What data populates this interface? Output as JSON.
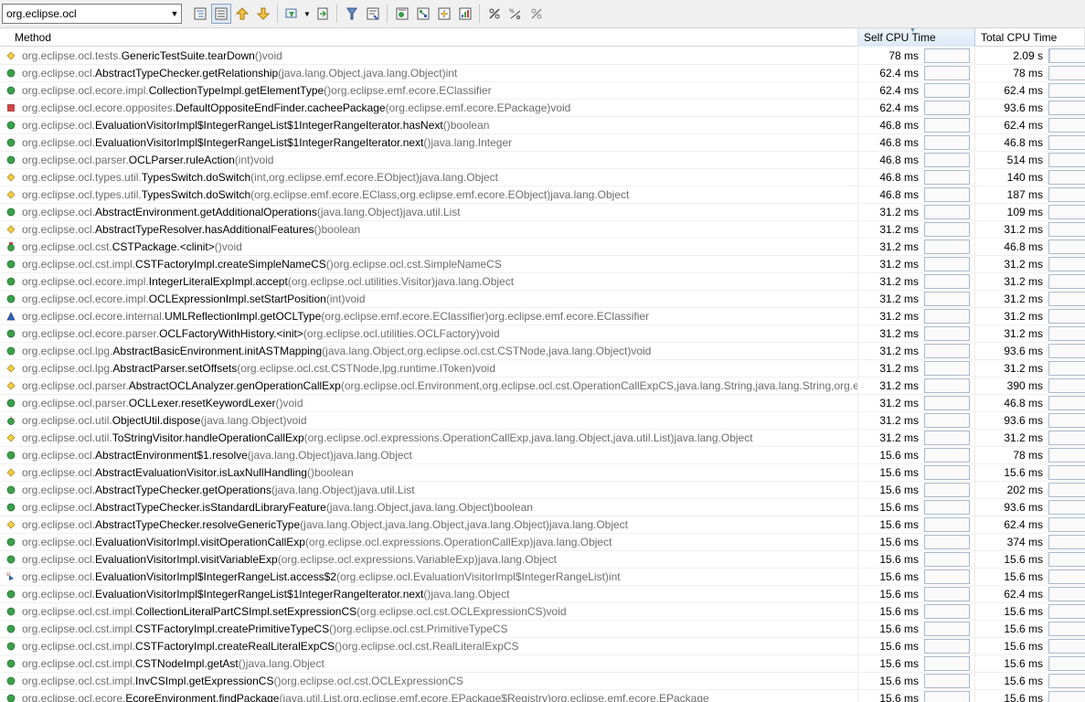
{
  "filter": {
    "value": "org.eclipse.ocl"
  },
  "toolbar": {
    "buttons": [
      {
        "name": "expand-tree-icon"
      },
      {
        "name": "flat-view-icon"
      },
      {
        "name": "navigate-up-icon"
      },
      {
        "name": "navigate-down-icon"
      },
      {
        "name": "filter-icon"
      },
      {
        "name": "export-icon"
      },
      {
        "name": "thread-icon"
      },
      {
        "name": "open-source-icon"
      },
      {
        "name": "hotspots-icon"
      },
      {
        "name": "callers-icon"
      },
      {
        "name": "callees-icon"
      },
      {
        "name": "merged-callees-icon"
      },
      {
        "name": "scale-icon"
      },
      {
        "name": "percent-icon"
      },
      {
        "name": "clear-icon"
      }
    ]
  },
  "columns": {
    "method": "Method",
    "self": "Self CPU Time",
    "total": "Total CPU Time"
  },
  "colors": {
    "public": "#3aa04a",
    "protected": "#e2b72a",
    "private": "#cf3a3a",
    "default": "#2f62b6",
    "selected_header": "#dde9f6"
  },
  "rows": [
    {
      "icon": "protected",
      "pkg": "org.eclipse.ocl.tests.",
      "cls": "GenericTestSuite.tearDown",
      "sig": "()void",
      "self": "78 ms",
      "total": "2.09 s",
      "total_fraction": 0.02
    },
    {
      "icon": "public",
      "pkg": "org.eclipse.ocl.",
      "cls": "AbstractTypeChecker.getRelationship",
      "sig": "(java.lang.Object,java.lang.Object)int",
      "self": "62.4 ms",
      "total": "78 ms",
      "total_fraction": 0
    },
    {
      "icon": "public",
      "pkg": "org.eclipse.ocl.ecore.impl.",
      "cls": "CollectionTypeImpl.getElementType",
      "sig": "()org.eclipse.emf.ecore.EClassifier",
      "self": "62.4 ms",
      "total": "62.4 ms",
      "total_fraction": 0
    },
    {
      "icon": "private",
      "pkg": "org.eclipse.ocl.ecore.opposites.",
      "cls": "DefaultOppositeEndFinder.cacheePackage",
      "sig": "(org.eclipse.emf.ecore.EPackage)void",
      "self": "62.4 ms",
      "total": "93.6 ms",
      "total_fraction": 0
    },
    {
      "icon": "public",
      "pkg": "org.eclipse.ocl.",
      "cls": "EvaluationVisitorImpl$IntegerRangeList$1IntegerRangeIterator.hasNext",
      "sig": "()boolean",
      "self": "46.8 ms",
      "total": "62.4 ms",
      "total_fraction": 0
    },
    {
      "icon": "public",
      "pkg": "org.eclipse.ocl.",
      "cls": "EvaluationVisitorImpl$IntegerRangeList$1IntegerRangeIterator.next",
      "sig": "()java.lang.Integer",
      "self": "46.8 ms",
      "total": "46.8 ms",
      "total_fraction": 0
    },
    {
      "icon": "public",
      "pkg": "org.eclipse.ocl.parser.",
      "cls": "OCLParser.ruleAction",
      "sig": "(int)void",
      "self": "46.8 ms",
      "total": "514 ms",
      "total_fraction": 0
    },
    {
      "icon": "protected",
      "pkg": "org.eclipse.ocl.types.util.",
      "cls": "TypesSwitch.doSwitch",
      "sig": "(int,org.eclipse.emf.ecore.EObject)java.lang.Object",
      "self": "46.8 ms",
      "total": "140 ms",
      "total_fraction": 0
    },
    {
      "icon": "protected",
      "pkg": "org.eclipse.ocl.types.util.",
      "cls": "TypesSwitch.doSwitch",
      "sig": "(org.eclipse.emf.ecore.EClass,org.eclipse.emf.ecore.EObject)java.lang.Object",
      "self": "46.8 ms",
      "total": "187 ms",
      "total_fraction": 0
    },
    {
      "icon": "public",
      "pkg": "org.eclipse.ocl.",
      "cls": "AbstractEnvironment.getAdditionalOperations",
      "sig": "(java.lang.Object)java.util.List",
      "self": "31.2 ms",
      "total": "109 ms",
      "total_fraction": 0
    },
    {
      "icon": "protected",
      "pkg": "org.eclipse.ocl.",
      "cls": "AbstractTypeResolver.hasAdditionalFeatures",
      "sig": "()boolean",
      "self": "31.2 ms",
      "total": "31.2 ms",
      "total_fraction": 0
    },
    {
      "icon": "static-init",
      "pkg": "org.eclipse.ocl.cst.",
      "cls": "CSTPackage.<clinit>",
      "sig": "()void",
      "self": "31.2 ms",
      "total": "46.8 ms",
      "total_fraction": 0
    },
    {
      "icon": "public",
      "pkg": "org.eclipse.ocl.cst.impl.",
      "cls": "CSTFactoryImpl.createSimpleNameCS",
      "sig": "()org.eclipse.ocl.cst.SimpleNameCS",
      "self": "31.2 ms",
      "total": "31.2 ms",
      "total_fraction": 0
    },
    {
      "icon": "public",
      "pkg": "org.eclipse.ocl.ecore.impl.",
      "cls": "IntegerLiteralExpImpl.accept",
      "sig": "(org.eclipse.ocl.utilities.Visitor)java.lang.Object",
      "self": "31.2 ms",
      "total": "31.2 ms",
      "total_fraction": 0
    },
    {
      "icon": "public",
      "pkg": "org.eclipse.ocl.ecore.impl.",
      "cls": "OCLExpressionImpl.setStartPosition",
      "sig": "(int)void",
      "self": "31.2 ms",
      "total": "31.2 ms",
      "total_fraction": 0
    },
    {
      "icon": "default",
      "pkg": "org.eclipse.ocl.ecore.internal.",
      "cls": "UMLReflectionImpl.getOCLType",
      "sig": "(org.eclipse.emf.ecore.EClassifier)org.eclipse.emf.ecore.EClassifier",
      "self": "31.2 ms",
      "total": "31.2 ms",
      "total_fraction": 0
    },
    {
      "icon": "public",
      "pkg": "org.eclipse.ocl.ecore.parser.",
      "cls": "OCLFactoryWithHistory.<init>",
      "sig": "(org.eclipse.ocl.utilities.OCLFactory)void",
      "self": "31.2 ms",
      "total": "31.2 ms",
      "total_fraction": 0
    },
    {
      "icon": "public",
      "pkg": "org.eclipse.ocl.lpg.",
      "cls": "AbstractBasicEnvironment.initASTMapping",
      "sig": "(java.lang.Object,org.eclipse.ocl.cst.CSTNode,java.lang.Object)void",
      "self": "31.2 ms",
      "total": "93.6 ms",
      "total_fraction": 0
    },
    {
      "icon": "protected",
      "pkg": "org.eclipse.ocl.lpg.",
      "cls": "AbstractParser.setOffsets",
      "sig": "(org.eclipse.ocl.cst.CSTNode,lpg.runtime.IToken)void",
      "self": "31.2 ms",
      "total": "31.2 ms",
      "total_fraction": 0
    },
    {
      "icon": "protected",
      "pkg": "org.eclipse.ocl.parser.",
      "cls": "AbstractOCLAnalyzer.genOperationCallExp",
      "sig": "(org.eclipse.ocl.Environment,org.eclipse.ocl.cst.OperationCallExpCS,java.lang.String,java.lang.String,org.eclip",
      "self": "31.2 ms",
      "total": "390 ms",
      "total_fraction": 0
    },
    {
      "icon": "public",
      "pkg": "org.eclipse.ocl.parser.",
      "cls": "OCLLexer.resetKeywordLexer",
      "sig": "()void",
      "self": "31.2 ms",
      "total": "46.8 ms",
      "total_fraction": 0
    },
    {
      "icon": "static-method",
      "pkg": "org.eclipse.ocl.util.",
      "cls": "ObjectUtil.dispose",
      "sig": "(java.lang.Object)void",
      "self": "31.2 ms",
      "total": "93.6 ms",
      "total_fraction": 0
    },
    {
      "icon": "protected",
      "pkg": "org.eclipse.ocl.util.",
      "cls": "ToStringVisitor.handleOperationCallExp",
      "sig": "(org.eclipse.ocl.expressions.OperationCallExp,java.lang.Object,java.util.List)java.lang.Object",
      "self": "31.2 ms",
      "total": "31.2 ms",
      "total_fraction": 0
    },
    {
      "icon": "public",
      "pkg": "org.eclipse.ocl.",
      "cls": "AbstractEnvironment$1.resolve",
      "sig": "(java.lang.Object)java.lang.Object",
      "self": "15.6 ms",
      "total": "78 ms",
      "total_fraction": 0
    },
    {
      "icon": "protected",
      "pkg": "org.eclipse.ocl.",
      "cls": "AbstractEvaluationVisitor.isLaxNullHandling",
      "sig": "()boolean",
      "self": "15.6 ms",
      "total": "15.6 ms",
      "total_fraction": 0
    },
    {
      "icon": "public",
      "pkg": "org.eclipse.ocl.",
      "cls": "AbstractTypeChecker.getOperations",
      "sig": "(java.lang.Object)java.util.List",
      "self": "15.6 ms",
      "total": "202 ms",
      "total_fraction": 0
    },
    {
      "icon": "public",
      "pkg": "org.eclipse.ocl.",
      "cls": "AbstractTypeChecker.isStandardLibraryFeature",
      "sig": "(java.lang.Object,java.lang.Object)boolean",
      "self": "15.6 ms",
      "total": "93.6 ms",
      "total_fraction": 0
    },
    {
      "icon": "protected",
      "pkg": "org.eclipse.ocl.",
      "cls": "AbstractTypeChecker.resolveGenericType",
      "sig": "(java.lang.Object,java.lang.Object,java.lang.Object)java.lang.Object",
      "self": "15.6 ms",
      "total": "62.4 ms",
      "total_fraction": 0
    },
    {
      "icon": "public",
      "pkg": "org.eclipse.ocl.",
      "cls": "EvaluationVisitorImpl.visitOperationCallExp",
      "sig": "(org.eclipse.ocl.expressions.OperationCallExp)java.lang.Object",
      "self": "15.6 ms",
      "total": "374 ms",
      "total_fraction": 0
    },
    {
      "icon": "public",
      "pkg": "org.eclipse.ocl.",
      "cls": "EvaluationVisitorImpl.visitVariableExp",
      "sig": "(org.eclipse.ocl.expressions.VariableExp)java.lang.Object",
      "self": "15.6 ms",
      "total": "15.6 ms",
      "total_fraction": 0
    },
    {
      "icon": "static-final",
      "pkg": "org.eclipse.ocl.",
      "cls": "EvaluationVisitorImpl$IntegerRangeList.access$2",
      "sig": "(org.eclipse.ocl.EvaluationVisitorImpl$IntegerRangeList)int",
      "self": "15.6 ms",
      "total": "15.6 ms",
      "total_fraction": 0
    },
    {
      "icon": "public",
      "pkg": "org.eclipse.ocl.",
      "cls": "EvaluationVisitorImpl$IntegerRangeList$1IntegerRangeIterator.next",
      "sig": "()java.lang.Object",
      "self": "15.6 ms",
      "total": "62.4 ms",
      "total_fraction": 0
    },
    {
      "icon": "public",
      "pkg": "org.eclipse.ocl.cst.impl.",
      "cls": "CollectionLiteralPartCSImpl.setExpressionCS",
      "sig": "(org.eclipse.ocl.cst.OCLExpressionCS)void",
      "self": "15.6 ms",
      "total": "15.6 ms",
      "total_fraction": 0
    },
    {
      "icon": "public",
      "pkg": "org.eclipse.ocl.cst.impl.",
      "cls": "CSTFactoryImpl.createPrimitiveTypeCS",
      "sig": "()org.eclipse.ocl.cst.PrimitiveTypeCS",
      "self": "15.6 ms",
      "total": "15.6 ms",
      "total_fraction": 0
    },
    {
      "icon": "public",
      "pkg": "org.eclipse.ocl.cst.impl.",
      "cls": "CSTFactoryImpl.createRealLiteralExpCS",
      "sig": "()org.eclipse.ocl.cst.RealLiteralExpCS",
      "self": "15.6 ms",
      "total": "15.6 ms",
      "total_fraction": 0
    },
    {
      "icon": "public",
      "pkg": "org.eclipse.ocl.cst.impl.",
      "cls": "CSTNodeImpl.getAst",
      "sig": "()java.lang.Object",
      "self": "15.6 ms",
      "total": "15.6 ms",
      "total_fraction": 0
    },
    {
      "icon": "public",
      "pkg": "org.eclipse.ocl.cst.impl.",
      "cls": "InvCSImpl.getExpressionCS",
      "sig": "()org.eclipse.ocl.cst.OCLExpressionCS",
      "self": "15.6 ms",
      "total": "15.6 ms",
      "total_fraction": 0
    },
    {
      "icon": "public",
      "pkg": "org.eclipse.ocl.ecore.",
      "cls": "EcoreEnvironment.findPackage",
      "sig": "(java.util.List,org.eclipse.emf.ecore.EPackage$Registry)org.eclipse.emf.ecore.EPackage",
      "self": "15.6 ms",
      "total": "15.6 ms",
      "total_fraction": 0
    }
  ]
}
